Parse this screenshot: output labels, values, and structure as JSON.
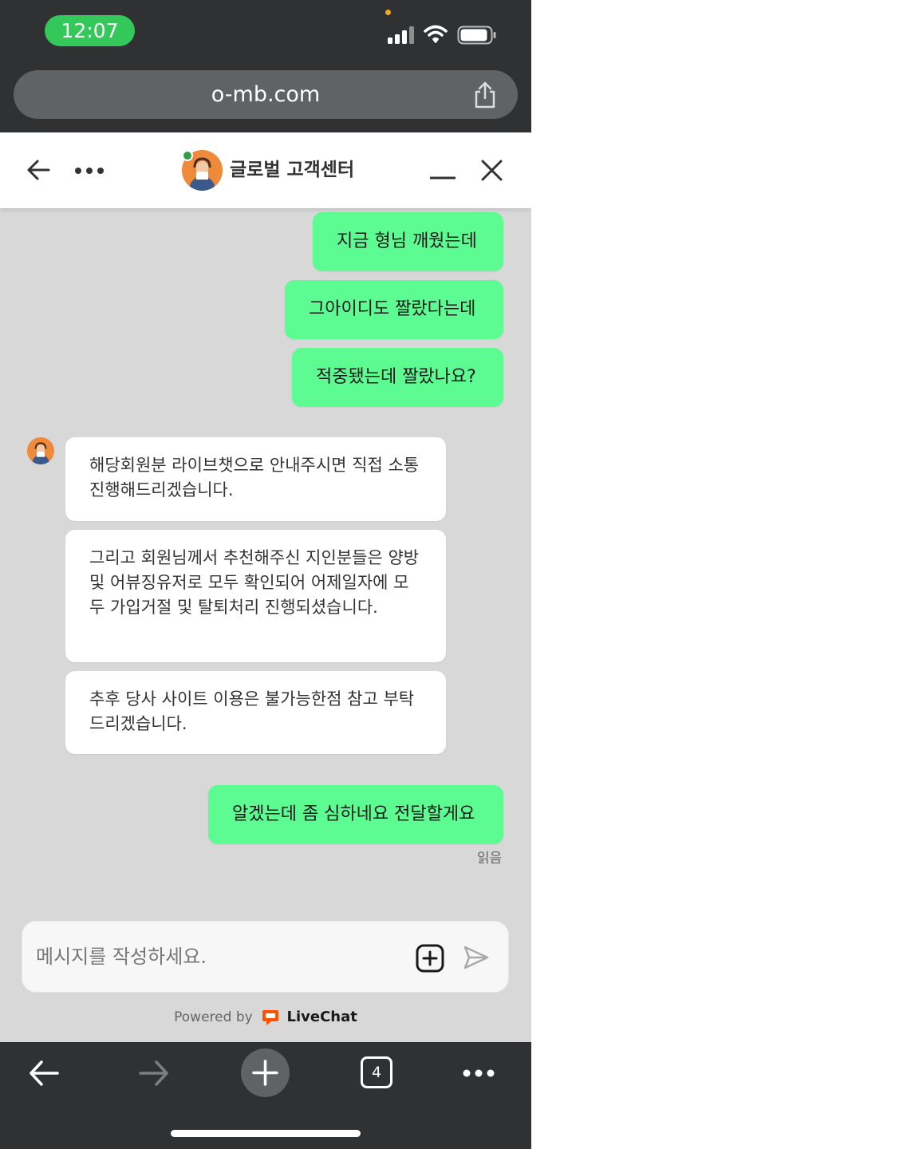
{
  "status_bar": {
    "time": "12:07"
  },
  "browser": {
    "url": "o-mb.com",
    "open_tabs_count": "4"
  },
  "chat": {
    "title": "글로벌 고객센터",
    "messages_top_outgoing": [
      "지금 형님 깨웠는데",
      "그아이디도 짤랐다는데",
      "적중됐는데 짤랐나요?"
    ],
    "messages_incoming": [
      "해당회원분 라이브챗으로 안내주시면 직접 소통진행해드리겠습니다.",
      "그리고 회원님께서 추천해주신 지인분들은 양방 및 어뷰징유저로 모두 확인되어 어제일자에 모두 가입거절 및 탈퇴처리 진행되셨습니다.",
      "추후 당사 사이트 이용은 불가능한점 참고 부탁드리겠습니다."
    ],
    "message_last_outgoing": "알겠는데 좀 심하네요 전달할게요",
    "read_receipt": "읽음",
    "composer_placeholder": "메시지를 작성하세요.",
    "powered_by": "Powered by",
    "brand": "LiveChat"
  },
  "colors": {
    "outgoing_bubble": "#5dfc92",
    "incoming_bubble": "#ffffff",
    "chat_background": "#d8d8d8",
    "browser_chrome": "#2f3133",
    "status_time_pill": "#34c759",
    "online_dot": "#2e9e4a",
    "livechat_logo": "#ff5100"
  },
  "icons": [
    "signal-icon",
    "wifi-icon",
    "battery-icon",
    "share-icon",
    "back-arrow-icon",
    "more-dots-icon",
    "minimize-icon",
    "close-icon",
    "attach-plus-icon",
    "send-icon",
    "forward-arrow-icon",
    "plus-icon"
  ]
}
